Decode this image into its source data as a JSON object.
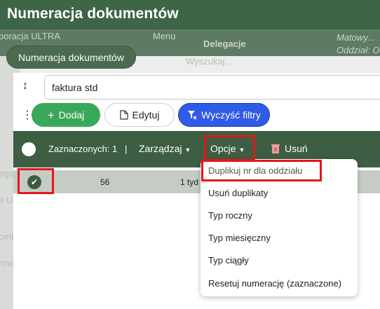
{
  "background": {
    "left_labels": [
      "boracja ULTRA",
      "ega",
      "a U",
      "omk",
      "rmo"
    ],
    "menu_label": "Menu",
    "delegacje": "Delegacje",
    "search_hint": "Wyszukaj...",
    "right_top": "Matowy...",
    "right_bottom": "Oddział: O"
  },
  "modal": {
    "title": "Numeracja dokumentów",
    "tab_label": "Numeracja dokumentów",
    "search_value": "faktura std",
    "buttons": {
      "add": "Dodaj",
      "edit": "Edytuj",
      "clear_filters": "Wyczyść filtry"
    },
    "toolbar": {
      "selected": "Zaznaczonych: 1",
      "separator": "|",
      "manage": "Zarządzaj",
      "options": "Opcje",
      "delete": "Usuń"
    },
    "row": {
      "col1": "56",
      "col2": "1 tyd"
    },
    "options_menu": [
      "Duplikuj nr dla oddziału",
      "Usuń duplikaty",
      "Typ roczny",
      "Typ miesięczny",
      "Typ ciągły",
      "Resetuj numerację (zaznaczone)"
    ]
  },
  "colors": {
    "header_green": "#3f6547",
    "toolbar_green": "#3d5e43",
    "add_green": "#3aa85a",
    "clear_blue": "#2f5be6",
    "highlight_red": "#e8141c"
  }
}
